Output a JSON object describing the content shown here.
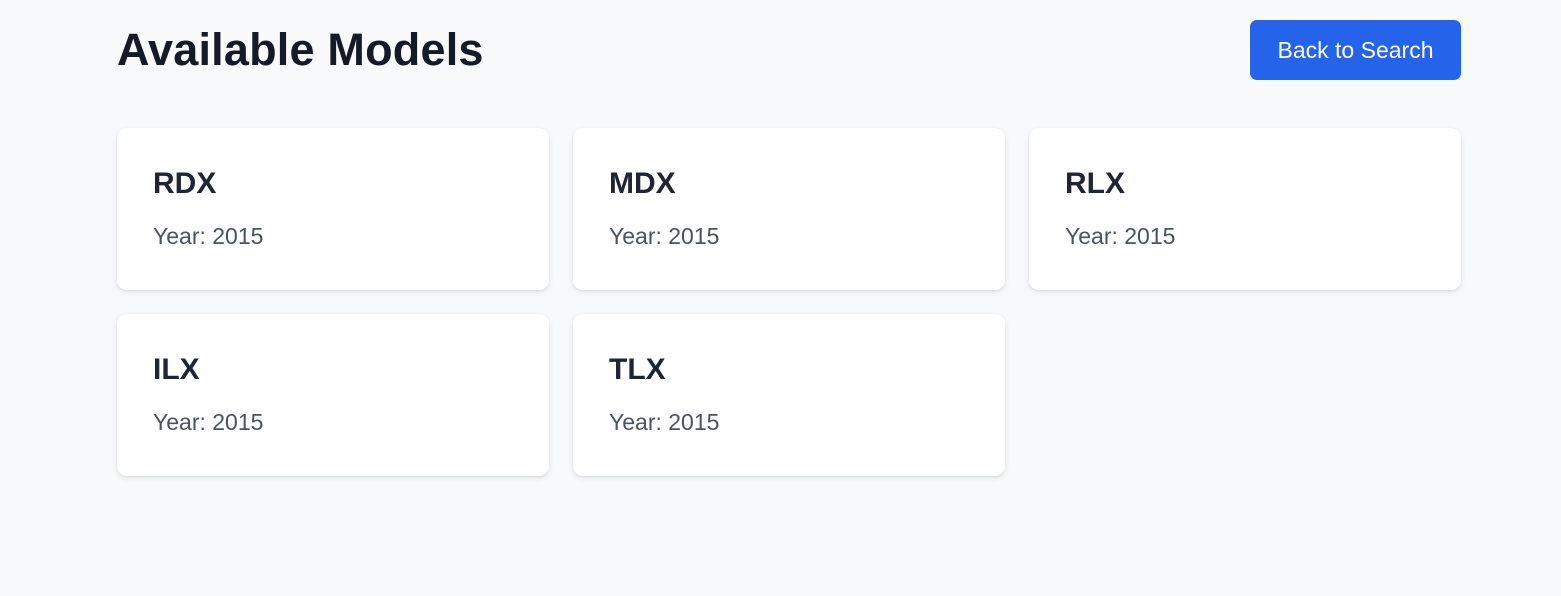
{
  "header": {
    "title": "Available Models",
    "back_label": "Back to Search"
  },
  "year_prefix": "Year:",
  "models": [
    {
      "name": "RDX",
      "year_text": "Year: 2015"
    },
    {
      "name": "MDX",
      "year_text": "Year: 2015"
    },
    {
      "name": "RLX",
      "year_text": "Year: 2015"
    },
    {
      "name": "ILX",
      "year_text": "Year: 2015"
    },
    {
      "name": "TLX",
      "year_text": "Year: 2015"
    }
  ],
  "colors": {
    "background": "#f8f9fb",
    "accent": "#2563eb",
    "title": "#141a26",
    "card": "#ffffff",
    "muted_text": "#4b5260"
  }
}
